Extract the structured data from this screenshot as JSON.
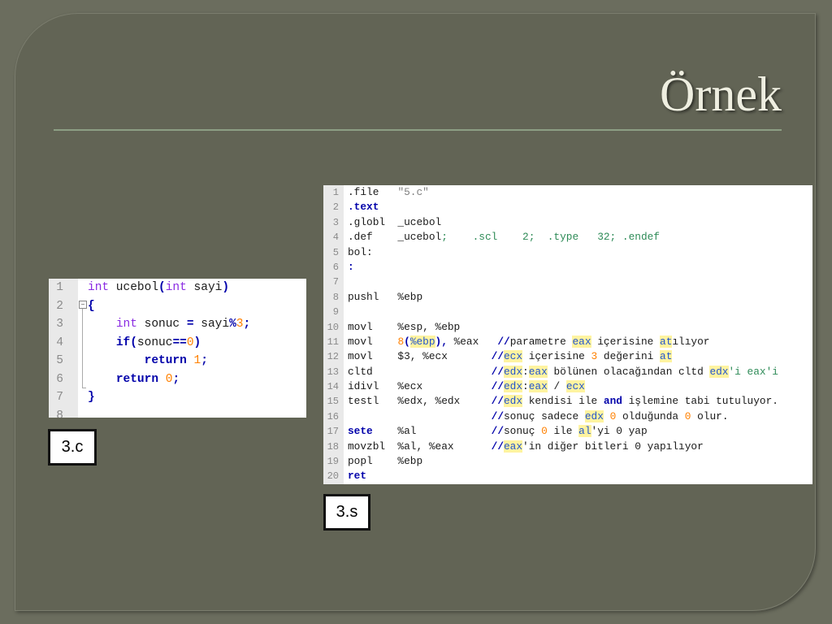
{
  "slide": {
    "title": "Örnek",
    "label_c": "3.c",
    "label_s": "3.s"
  },
  "code_c": {
    "line_numbers": [
      "1",
      "2",
      "3",
      "4",
      "5",
      "6",
      "7",
      "8"
    ],
    "lines": [
      [
        {
          "t": "int",
          "c": "kw"
        },
        {
          "t": " ucebol"
        },
        {
          "t": "(",
          "c": "kb"
        },
        {
          "t": "int",
          "c": "kw"
        },
        {
          "t": " sayi"
        },
        {
          "t": ")",
          "c": "kb"
        }
      ],
      [
        {
          "t": "{",
          "c": "kb"
        }
      ],
      [
        {
          "t": "    "
        },
        {
          "t": "int",
          "c": "kw"
        },
        {
          "t": " sonuc "
        },
        {
          "t": "=",
          "c": "kb"
        },
        {
          "t": " sayi"
        },
        {
          "t": "%",
          "c": "kb"
        },
        {
          "t": "3",
          "c": "num"
        },
        {
          "t": ";",
          "c": "kb"
        }
      ],
      [
        {
          "t": "    "
        },
        {
          "t": "if",
          "c": "kb"
        },
        {
          "t": "(",
          "c": "kb"
        },
        {
          "t": "sonuc"
        },
        {
          "t": "==",
          "c": "kb"
        },
        {
          "t": "0",
          "c": "num"
        },
        {
          "t": ")",
          "c": "kb"
        }
      ],
      [
        {
          "t": "        "
        },
        {
          "t": "return",
          "c": "kb"
        },
        {
          "t": " "
        },
        {
          "t": "1",
          "c": "num"
        },
        {
          "t": ";",
          "c": "kb"
        }
      ],
      [
        {
          "t": "    "
        },
        {
          "t": "return",
          "c": "kb"
        },
        {
          "t": " "
        },
        {
          "t": "0",
          "c": "num"
        },
        {
          "t": ";",
          "c": "kb"
        }
      ],
      [
        {
          "t": "}",
          "c": "kb"
        }
      ],
      []
    ]
  },
  "code_s": {
    "line_numbers": [
      "1",
      "2",
      "3",
      "4",
      "5",
      "6",
      "7",
      "8",
      "9",
      "10",
      "11",
      "12",
      "13",
      "14",
      "15",
      "16",
      "17",
      "18",
      "19",
      "20"
    ],
    "lines": [
      [
        {
          "t": ".file   "
        },
        {
          "t": "\"5.c\"",
          "c": "str"
        }
      ],
      [
        {
          "t": ".text",
          "c": "kb"
        }
      ],
      [
        {
          "t": ".globl  _ucebol"
        }
      ],
      [
        {
          "t": ".def    _ucebol"
        },
        {
          "t": ";    .scl    2;  .type   32; .endef",
          "c": "cm2"
        }
      ],
      [
        {
          "t": "bol:"
        }
      ],
      [
        {
          "t": ":",
          "c": "kb"
        }
      ],
      [],
      [
        {
          "t": "pushl   %ebp"
        }
      ],
      [],
      [
        {
          "t": "movl    %esp, %ebp"
        }
      ],
      [
        {
          "t": "movl    "
        },
        {
          "t": "8",
          "c": "num"
        },
        {
          "t": "(",
          "c": "kb"
        },
        {
          "t": "%ebp",
          "c": "hl"
        },
        {
          "t": "),",
          "c": "kb"
        },
        {
          "t": " %eax   "
        },
        {
          "t": "//",
          "c": "kb"
        },
        {
          "t": "parametre "
        },
        {
          "t": "eax",
          "c": "hl"
        },
        {
          "t": " içerisine "
        },
        {
          "t": "at",
          "c": "hl"
        },
        {
          "t": "ılıyor"
        }
      ],
      [
        {
          "t": "movl    $3, %ecx       "
        },
        {
          "t": "//",
          "c": "kb"
        },
        {
          "t": "ecx",
          "c": "hl"
        },
        {
          "t": " içerisine "
        },
        {
          "t": "3",
          "c": "num"
        },
        {
          "t": " değerini "
        },
        {
          "t": "at",
          "c": "hl"
        }
      ],
      [
        {
          "t": "cltd                   "
        },
        {
          "t": "//",
          "c": "kb"
        },
        {
          "t": "edx",
          "c": "hl"
        },
        {
          "t": ":"
        },
        {
          "t": "eax",
          "c": "hl"
        },
        {
          "t": " bölünen olacağından cltd "
        },
        {
          "t": "edx",
          "c": "hl"
        },
        {
          "t": "'i eax'i",
          "c": "cm2"
        }
      ],
      [
        {
          "t": "idivl   %ecx           "
        },
        {
          "t": "//",
          "c": "kb"
        },
        {
          "t": "edx",
          "c": "hl"
        },
        {
          "t": ":"
        },
        {
          "t": "eax",
          "c": "hl"
        },
        {
          "t": " / "
        },
        {
          "t": "ecx",
          "c": "hl"
        }
      ],
      [
        {
          "t": "testl   %edx, %edx     "
        },
        {
          "t": "//",
          "c": "kb"
        },
        {
          "t": "edx",
          "c": "hl"
        },
        {
          "t": " kendisi ile "
        },
        {
          "t": "and",
          "c": "kb"
        },
        {
          "t": " işlemine tabi tutuluyor."
        }
      ],
      [
        {
          "t": "                       "
        },
        {
          "t": "//",
          "c": "kb"
        },
        {
          "t": "sonuç sadece "
        },
        {
          "t": "edx",
          "c": "hl"
        },
        {
          "t": " "
        },
        {
          "t": "0",
          "c": "num"
        },
        {
          "t": " olduğunda "
        },
        {
          "t": "0",
          "c": "num"
        },
        {
          "t": " olur."
        }
      ],
      [
        {
          "t": "sete",
          "c": "kb"
        },
        {
          "t": "    %al            "
        },
        {
          "t": "//",
          "c": "kb"
        },
        {
          "t": "sonuç "
        },
        {
          "t": "0",
          "c": "num"
        },
        {
          "t": " ile "
        },
        {
          "t": "al",
          "c": "hl"
        },
        {
          "t": "'yi 0 yap"
        }
      ],
      [
        {
          "t": "movzbl  %al, %eax      "
        },
        {
          "t": "//",
          "c": "kb"
        },
        {
          "t": "eax",
          "c": "hl"
        },
        {
          "t": "'in diğer bitleri 0 yapılıyor"
        }
      ],
      [
        {
          "t": "popl    %ebp"
        }
      ],
      [
        {
          "t": "ret",
          "c": "kb"
        }
      ]
    ]
  }
}
